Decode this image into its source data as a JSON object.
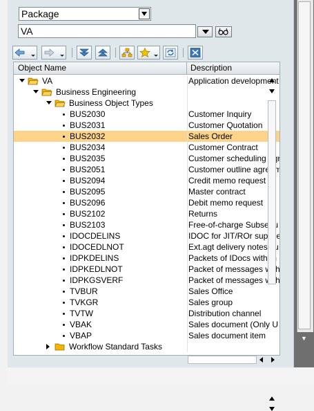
{
  "selector": {
    "value": "Package"
  },
  "object_input": {
    "value": "VA"
  },
  "columns": {
    "name": "Object Name",
    "description": "Description"
  },
  "tree": [
    {
      "name": "VA",
      "desc": "Application development",
      "level": 0,
      "type": "folder-open",
      "selected": false
    },
    {
      "name": "Business Engineering",
      "desc": "",
      "level": 1,
      "type": "folder-open",
      "selected": false
    },
    {
      "name": "Business Object Types",
      "desc": "",
      "level": 2,
      "type": "folder-open",
      "selected": false
    },
    {
      "name": "BUS2030",
      "desc": "Customer Inquiry",
      "level": 3,
      "type": "leaf",
      "selected": false
    },
    {
      "name": "BUS2031",
      "desc": "Customer Quotation",
      "level": 3,
      "type": "leaf",
      "selected": false
    },
    {
      "name": "BUS2032",
      "desc": "Sales Order",
      "level": 3,
      "type": "leaf",
      "selected": true
    },
    {
      "name": "BUS2034",
      "desc": "Customer Contract",
      "level": 3,
      "type": "leaf",
      "selected": false
    },
    {
      "name": "BUS2035",
      "desc": "Customer scheduling agr",
      "level": 3,
      "type": "leaf",
      "selected": false
    },
    {
      "name": "BUS2051",
      "desc": "Customer outline agreem",
      "level": 3,
      "type": "leaf",
      "selected": false
    },
    {
      "name": "BUS2094",
      "desc": "Credit memo request",
      "level": 3,
      "type": "leaf",
      "selected": false
    },
    {
      "name": "BUS2095",
      "desc": "Master contract",
      "level": 3,
      "type": "leaf",
      "selected": false
    },
    {
      "name": "BUS2096",
      "desc": "Debit memo request",
      "level": 3,
      "type": "leaf",
      "selected": false
    },
    {
      "name": "BUS2102",
      "desc": "Returns",
      "level": 3,
      "type": "leaf",
      "selected": false
    },
    {
      "name": "BUS2103",
      "desc": "Free-of-charge Subsequ",
      "level": 3,
      "type": "leaf",
      "selected": false
    },
    {
      "name": "IDOCDELINS",
      "desc": "IDOC for JIT/ROr supplie",
      "level": 3,
      "type": "leaf",
      "selected": false
    },
    {
      "name": "IDOCEDLNOT",
      "desc": "Ext.agt delivery notes su",
      "level": 3,
      "type": "leaf",
      "selected": false
    },
    {
      "name": "IDPKDELINS",
      "desc": "Packets of IDocs with m",
      "level": 3,
      "type": "leaf",
      "selected": false
    },
    {
      "name": "IDPKEDLNOT",
      "desc": "Packet of messages with",
      "level": 3,
      "type": "leaf",
      "selected": false
    },
    {
      "name": "IDPKGSVERF",
      "desc": "Packet of messages with",
      "level": 3,
      "type": "leaf",
      "selected": false
    },
    {
      "name": "TVBUR",
      "desc": "Sales Office",
      "level": 3,
      "type": "leaf",
      "selected": false
    },
    {
      "name": "TVKGR",
      "desc": "Sales group",
      "level": 3,
      "type": "leaf",
      "selected": false
    },
    {
      "name": "TVTW",
      "desc": "Distribution channel",
      "level": 3,
      "type": "leaf",
      "selected": false
    },
    {
      "name": "VBAK",
      "desc": "Sales document (Only U",
      "level": 3,
      "type": "leaf",
      "selected": false
    },
    {
      "name": "VBAP",
      "desc": "Sales document item",
      "level": 3,
      "type": "leaf",
      "selected": false
    },
    {
      "name": "Workflow Standard Tasks",
      "desc": "",
      "level": 2,
      "type": "folder-closed",
      "selected": false
    }
  ],
  "toolbar_icons": [
    "back-icon",
    "forward-icon",
    "expand-all-icon",
    "collapse-all-icon",
    "hierarchy-icon",
    "favorites-icon",
    "refresh-icon",
    "close-icon"
  ],
  "colors": {
    "selection": "#fbd48a",
    "folder": "#f4b400",
    "panel": "#dfe7ea"
  }
}
